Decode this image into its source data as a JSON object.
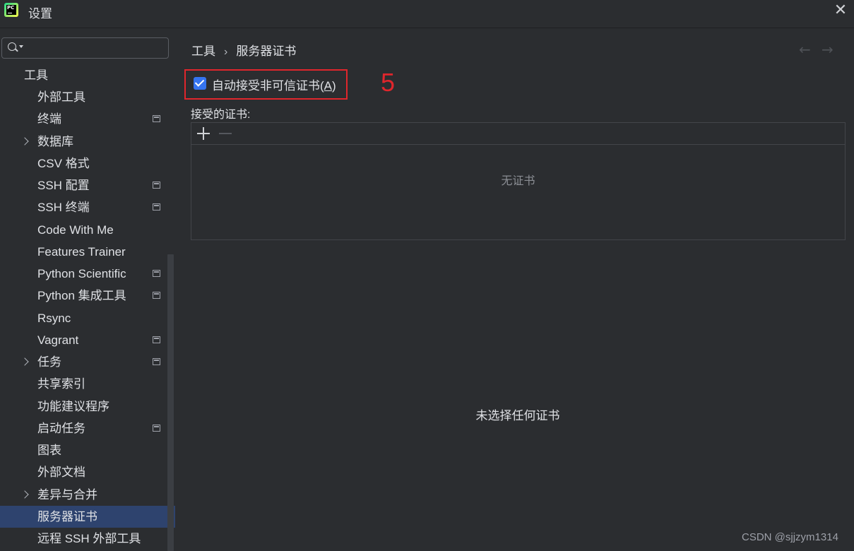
{
  "window": {
    "title": "设置",
    "app_logo_text": "PC"
  },
  "sidebar": {
    "search_placeholder": "",
    "items": [
      {
        "label": "工具",
        "level": "root",
        "chevron": false,
        "project_icon": false,
        "selected": false
      },
      {
        "label": "外部工具",
        "level": "child",
        "chevron": false,
        "project_icon": false,
        "selected": false
      },
      {
        "label": "终端",
        "level": "child",
        "chevron": false,
        "project_icon": true,
        "selected": false
      },
      {
        "label": "数据库",
        "level": "child",
        "chevron": true,
        "project_icon": false,
        "selected": false
      },
      {
        "label": "CSV 格式",
        "level": "child",
        "chevron": false,
        "project_icon": false,
        "selected": false
      },
      {
        "label": "SSH 配置",
        "level": "child",
        "chevron": false,
        "project_icon": true,
        "selected": false
      },
      {
        "label": "SSH 终端",
        "level": "child",
        "chevron": false,
        "project_icon": true,
        "selected": false
      },
      {
        "label": "Code With Me",
        "level": "child",
        "chevron": false,
        "project_icon": false,
        "selected": false
      },
      {
        "label": "Features Trainer",
        "level": "child",
        "chevron": false,
        "project_icon": false,
        "selected": false
      },
      {
        "label": "Python Scientific",
        "level": "child",
        "chevron": false,
        "project_icon": true,
        "selected": false
      },
      {
        "label": "Python 集成工具",
        "level": "child",
        "chevron": false,
        "project_icon": true,
        "selected": false
      },
      {
        "label": "Rsync",
        "level": "child",
        "chevron": false,
        "project_icon": false,
        "selected": false
      },
      {
        "label": "Vagrant",
        "level": "child",
        "chevron": false,
        "project_icon": true,
        "selected": false
      },
      {
        "label": "任务",
        "level": "child",
        "chevron": true,
        "project_icon": true,
        "selected": false
      },
      {
        "label": "共享索引",
        "level": "child",
        "chevron": false,
        "project_icon": false,
        "selected": false
      },
      {
        "label": "功能建议程序",
        "level": "child",
        "chevron": false,
        "project_icon": false,
        "selected": false
      },
      {
        "label": "启动任务",
        "level": "child",
        "chevron": false,
        "project_icon": true,
        "selected": false
      },
      {
        "label": "图表",
        "level": "child",
        "chevron": false,
        "project_icon": false,
        "selected": false
      },
      {
        "label": "外部文档",
        "level": "child",
        "chevron": false,
        "project_icon": false,
        "selected": false
      },
      {
        "label": "差异与合并",
        "level": "child",
        "chevron": true,
        "project_icon": false,
        "selected": false
      },
      {
        "label": "服务器证书",
        "level": "child",
        "chevron": false,
        "project_icon": false,
        "selected": true
      },
      {
        "label": "远程 SSH 外部工具",
        "level": "child",
        "chevron": false,
        "project_icon": false,
        "selected": false
      }
    ]
  },
  "breadcrumb": {
    "parent": "工具",
    "separator": "›",
    "current": "服务器证书"
  },
  "settings": {
    "accept_untrusted_label": "自动接受非可信证书(",
    "accept_untrusted_mnemonic": "A",
    "accept_untrusted_suffix": ")",
    "accept_untrusted_checked": true,
    "annotation_number": "5",
    "accepted_certs_label": "接受的证书:",
    "empty_list_text": "无证书",
    "no_selection_text": "未选择任何证书"
  },
  "footer": {
    "watermark_credit": "CSDN @sjjzym1314"
  },
  "colors": {
    "background": "#2b2d30",
    "selection": "#2e436e",
    "accent": "#3574f0",
    "annotation_red": "#e0262c"
  }
}
